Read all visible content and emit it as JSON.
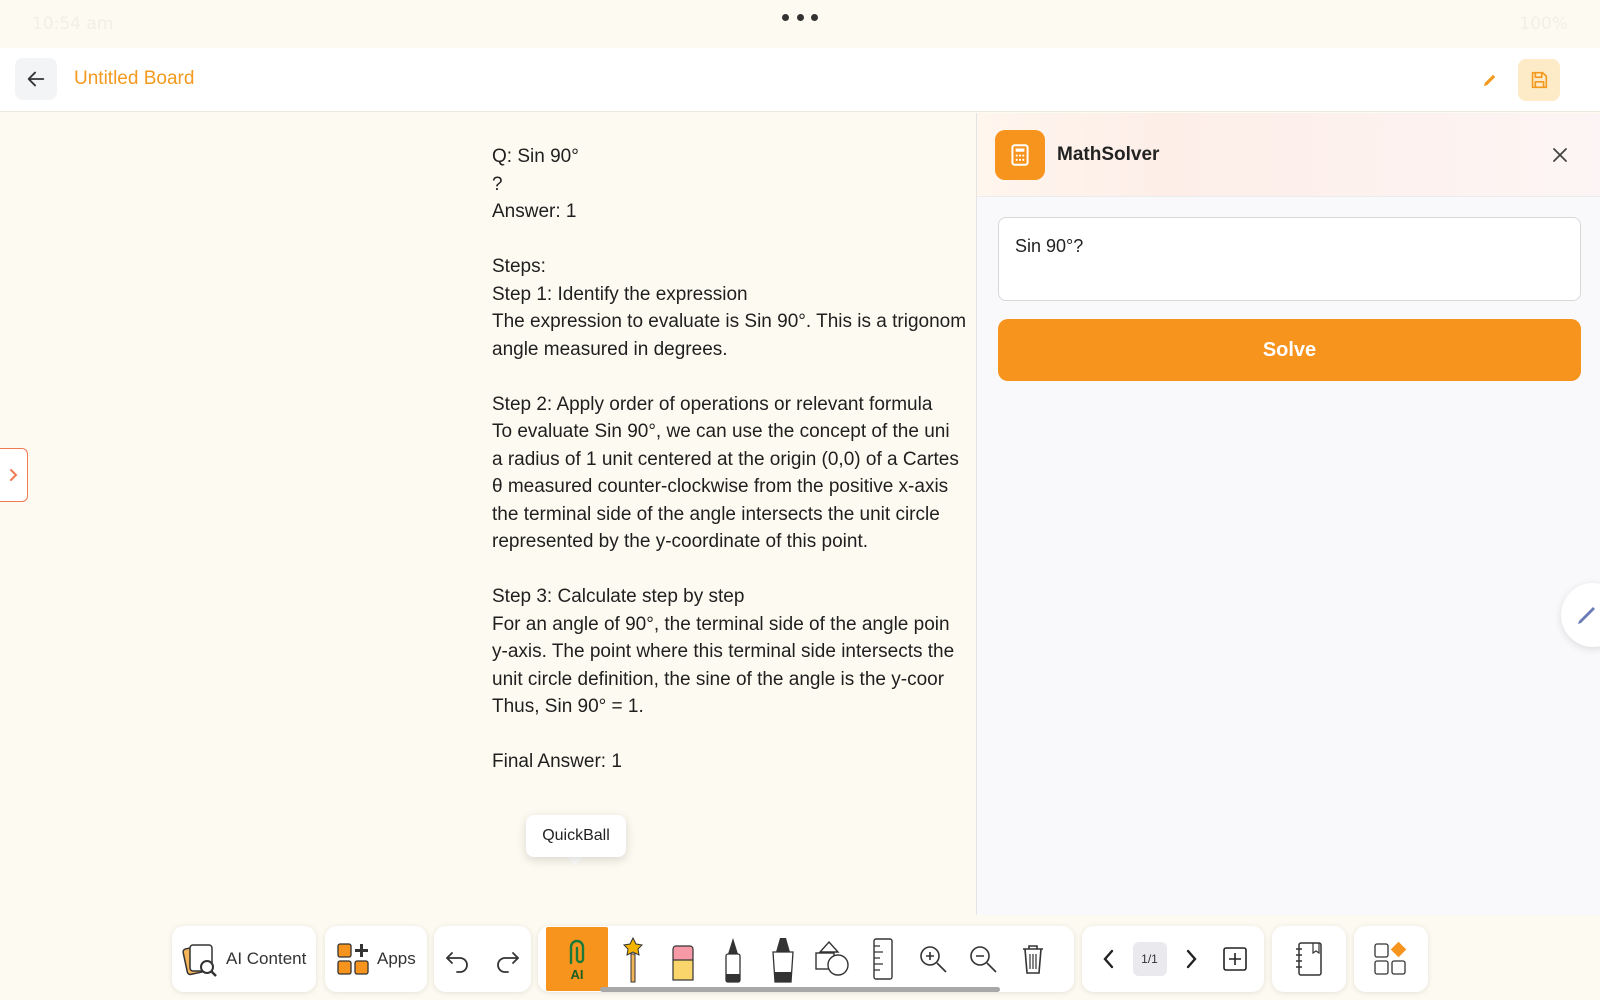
{
  "status_bar": {
    "time": "10:54 am",
    "battery": "100%"
  },
  "header": {
    "title": "Untitled Board"
  },
  "board": {
    "lines": [
      "Q: Sin 90°",
      "?",
      "Answer: 1",
      "",
      "Steps:",
      "Step 1: Identify the expression",
      "The expression to evaluate is Sin 90°. This is a trigonom",
      "angle measured in degrees.",
      "",
      "Step 2: Apply order of operations or relevant formula",
      "To evaluate Sin 90°, we can use the concept of the uni",
      "a radius of 1 unit centered at the origin (0,0) of a Cartes",
      "θ measured counter-clockwise from the positive x-axis",
      "the terminal side of the angle intersects the unit circle ",
      "represented by the y-coordinate of this point.",
      "",
      "Step 3: Calculate step by step",
      "For an angle of 90°, the terminal side of the angle poin",
      "y-axis. The point where this terminal side intersects the",
      "unit circle definition, the sine of the angle is the y-coor",
      "Thus, Sin 90° = 1.",
      "",
      "Final Answer: 1"
    ],
    "quickball_label": "QuickBall"
  },
  "math_solver": {
    "title": "MathSolver",
    "input_value": "Sin 90°?",
    "solve_label": "Solve"
  },
  "toolbar": {
    "ai_content_label": "AI Content",
    "apps_label": "Apps",
    "ai_tool_label": "AI",
    "page_indicator": "1/1"
  },
  "colors": {
    "accent": "#f7941d",
    "title": "#f39a1e",
    "background": "#fdfbf1"
  }
}
